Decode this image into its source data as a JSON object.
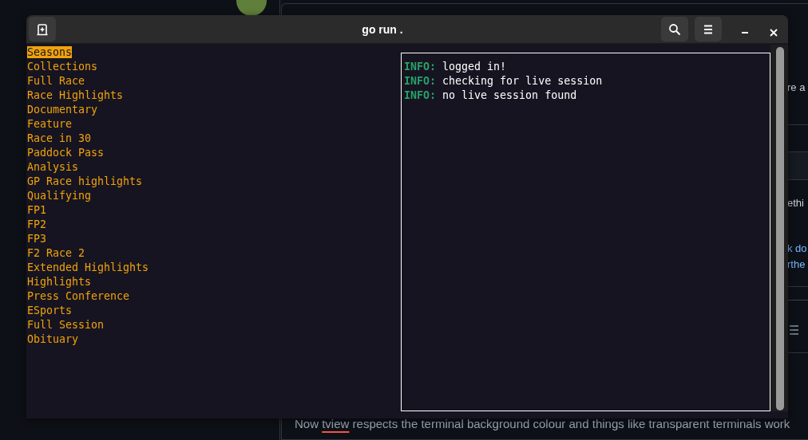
{
  "window": {
    "title": "go run ."
  },
  "menu": [
    {
      "label": "Seasons",
      "selected": true
    },
    {
      "label": "Collections",
      "selected": false
    },
    {
      "label": "Full Race",
      "selected": false
    },
    {
      "label": "Race Highlights",
      "selected": false
    },
    {
      "label": "Documentary",
      "selected": false
    },
    {
      "label": "Feature",
      "selected": false
    },
    {
      "label": "Race in 30",
      "selected": false
    },
    {
      "label": "Paddock Pass",
      "selected": false
    },
    {
      "label": "Analysis",
      "selected": false
    },
    {
      "label": "GP Race highlights",
      "selected": false
    },
    {
      "label": "Qualifying",
      "selected": false
    },
    {
      "label": "FP1",
      "selected": false
    },
    {
      "label": "FP2",
      "selected": false
    },
    {
      "label": "FP3",
      "selected": false
    },
    {
      "label": "F2 Race 2",
      "selected": false
    },
    {
      "label": "Extended Highlights",
      "selected": false
    },
    {
      "label": "Highlights",
      "selected": false
    },
    {
      "label": "Press Conference",
      "selected": false
    },
    {
      "label": "ESports",
      "selected": false
    },
    {
      "label": "Full Session",
      "selected": false
    },
    {
      "label": "Obituary",
      "selected": false
    }
  ],
  "log": [
    {
      "kind": "info",
      "level": "INFO:",
      "message": "logged in!"
    },
    {
      "kind": "info",
      "level": "INFO:",
      "message": "checking for live session"
    },
    {
      "kind": "info",
      "level": "INFO:",
      "message": "no live session found"
    }
  ],
  "background": {
    "fragments": [
      {
        "text": "re a",
        "color": "#c9d1d9"
      },
      {
        "text": "ethi",
        "color": "#c9d1d9"
      },
      {
        "text": "k do",
        "color": "#79b8ff"
      },
      {
        "text": "rthe",
        "color": "#79b8ff"
      }
    ],
    "sentence": {
      "before": "Now ",
      "flagged": "tview",
      "after": " respects the terminal background colour and things like transparent terminals work"
    }
  }
}
